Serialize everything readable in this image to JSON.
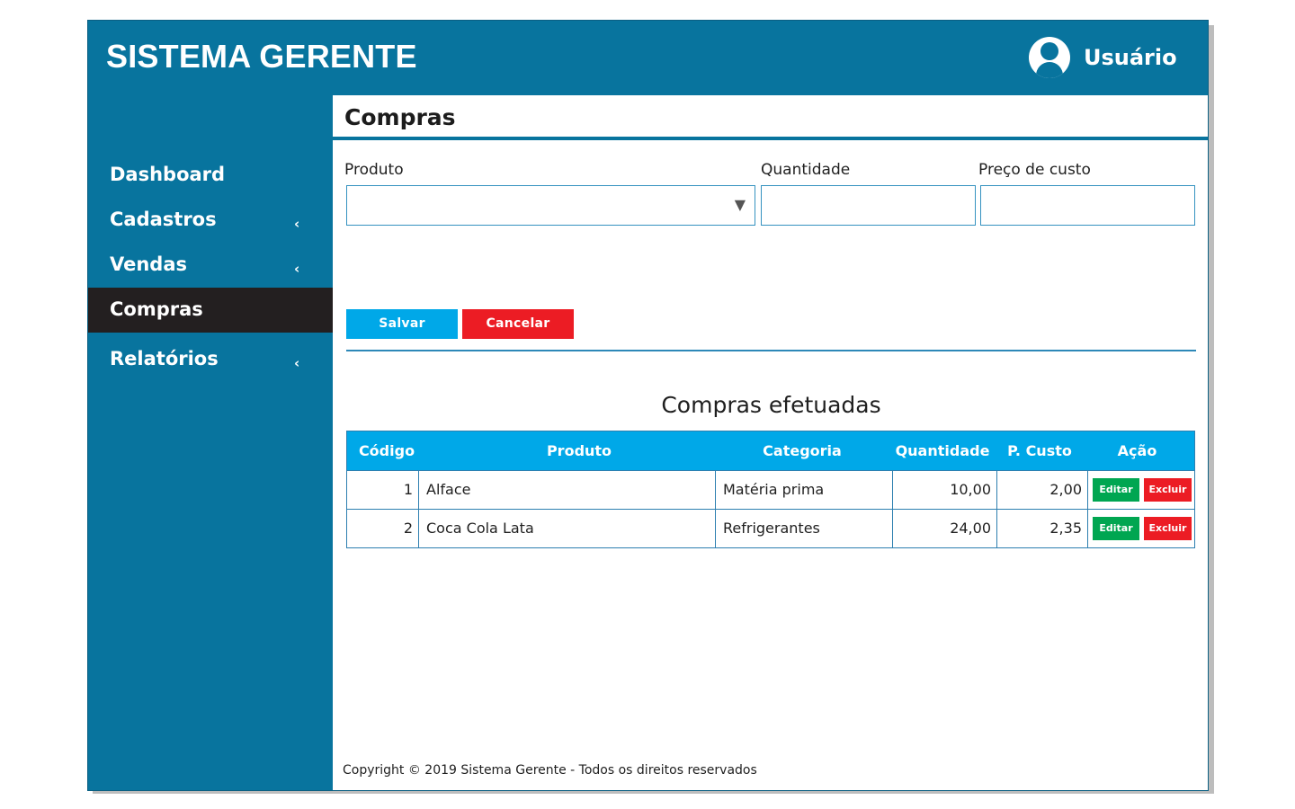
{
  "header": {
    "brand": "SISTEMA GERENTE",
    "user_label": "Usuário"
  },
  "sidebar": {
    "items": [
      {
        "label": "Dashboard",
        "chevron": ""
      },
      {
        "label": "Cadastros",
        "chevron": "‹"
      },
      {
        "label": "Vendas",
        "chevron": "‹"
      },
      {
        "label": "Compras",
        "chevron": ""
      },
      {
        "label": "Relatórios",
        "chevron": "‹"
      }
    ],
    "active": "Compras"
  },
  "page": {
    "title": "Compras"
  },
  "form": {
    "produto_label": "Produto",
    "produto_value": "",
    "quantidade_label": "Quantidade",
    "quantidade_value": "",
    "preco_label": "Preço de custo",
    "preco_value": "",
    "caret": "▼",
    "save_label": "Salvar",
    "cancel_label": "Cancelar"
  },
  "purchases": {
    "title": "Compras efetuadas",
    "columns": [
      "Código",
      "Produto",
      "Categoria",
      "Quantidade",
      "P. Custo",
      "Ação"
    ],
    "edit_label": "Editar",
    "delete_label": "Excluir",
    "rows": [
      {
        "codigo": "1",
        "produto": "Alface",
        "categoria": "Matéria prima",
        "quantidade": "10,00",
        "custo": "2,00"
      },
      {
        "codigo": "2",
        "produto": "Coca Cola Lata",
        "categoria": "Refrigerantes",
        "quantidade": "24,00",
        "custo": "2,35"
      }
    ]
  },
  "footer": {
    "text": "Copyright © 2019 Sistema Gerente - Todos os direitos reservados"
  },
  "colors": {
    "primary": "#08749e",
    "active_nav": "#231f20",
    "table_header": "#00a8e8",
    "save": "#00a8e8",
    "cancel": "#ec1c24",
    "edit": "#00a651",
    "delete": "#ec1c24"
  },
  "icons": {
    "user": "user-avatar-icon",
    "chevron": "chevron-left-icon",
    "caret": "caret-down-icon"
  }
}
